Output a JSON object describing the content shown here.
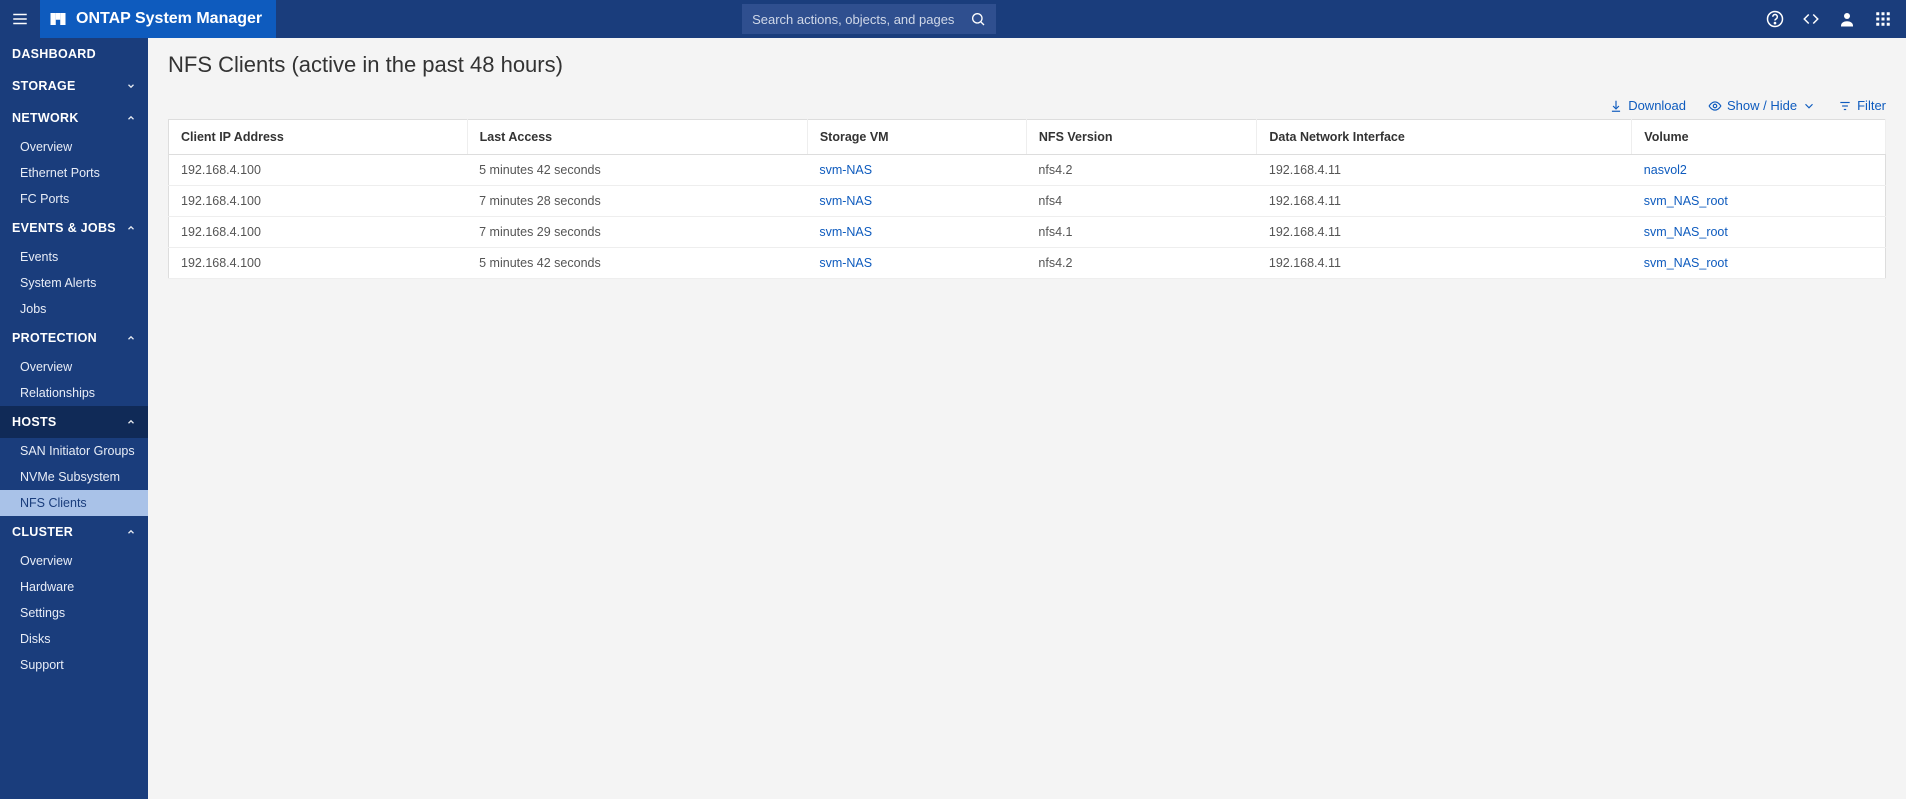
{
  "app": {
    "title": "ONTAP System Manager"
  },
  "search": {
    "placeholder": "Search actions, objects, and pages"
  },
  "sidebar": [
    {
      "label": "DASHBOARD",
      "type": "header",
      "chev": ""
    },
    {
      "label": "STORAGE",
      "type": "header",
      "chev": "down"
    },
    {
      "label": "NETWORK",
      "type": "header",
      "chev": "up"
    },
    {
      "label": "Overview",
      "type": "item"
    },
    {
      "label": "Ethernet Ports",
      "type": "item"
    },
    {
      "label": "FC Ports",
      "type": "item"
    },
    {
      "label": "EVENTS & JOBS",
      "type": "header",
      "chev": "up"
    },
    {
      "label": "Events",
      "type": "item"
    },
    {
      "label": "System Alerts",
      "type": "item"
    },
    {
      "label": "Jobs",
      "type": "item"
    },
    {
      "label": "PROTECTION",
      "type": "header",
      "chev": "up"
    },
    {
      "label": "Overview",
      "type": "item"
    },
    {
      "label": "Relationships",
      "type": "item"
    },
    {
      "label": "HOSTS",
      "type": "header",
      "chev": "up",
      "selected": true
    },
    {
      "label": "SAN Initiator Groups",
      "type": "item"
    },
    {
      "label": "NVMe Subsystem",
      "type": "item"
    },
    {
      "label": "NFS Clients",
      "type": "item",
      "active": true
    },
    {
      "label": "CLUSTER",
      "type": "header",
      "chev": "up"
    },
    {
      "label": "Overview",
      "type": "item"
    },
    {
      "label": "Hardware",
      "type": "item"
    },
    {
      "label": "Settings",
      "type": "item"
    },
    {
      "label": "Disks",
      "type": "item"
    },
    {
      "label": "Support",
      "type": "item"
    }
  ],
  "page": {
    "title": "NFS Clients (active in the past 48 hours)"
  },
  "toolbar": {
    "download": "Download",
    "showhide": "Show / Hide",
    "filter": "Filter"
  },
  "table": {
    "headers": [
      "Client IP Address",
      "Last Access",
      "Storage VM",
      "NFS Version",
      "Data Network Interface",
      "Volume"
    ],
    "rows": [
      {
        "ip": "192.168.4.100",
        "last": "5 minutes 42 seconds",
        "svm": "svm-NAS",
        "nfsver": "nfs4.2",
        "iface": "192.168.4.11",
        "vol": "nasvol2"
      },
      {
        "ip": "192.168.4.100",
        "last": "7 minutes 28 seconds",
        "svm": "svm-NAS",
        "nfsver": "nfs4",
        "iface": "192.168.4.11",
        "vol": "svm_NAS_root"
      },
      {
        "ip": "192.168.4.100",
        "last": "7 minutes 29 seconds",
        "svm": "svm-NAS",
        "nfsver": "nfs4.1",
        "iface": "192.168.4.11",
        "vol": "svm_NAS_root"
      },
      {
        "ip": "192.168.4.100",
        "last": "5 minutes 42 seconds",
        "svm": "svm-NAS",
        "nfsver": "nfs4.2",
        "iface": "192.168.4.11",
        "vol": "svm_NAS_root"
      }
    ]
  }
}
